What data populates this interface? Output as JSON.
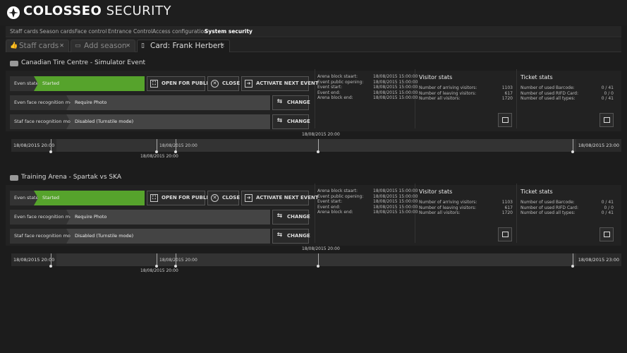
{
  "app": {
    "brand_bold": "COLOSSEO",
    "brand_rest": "SECURITY",
    "logo_icon": "colosseo-logo-icon"
  },
  "nav": {
    "items": [
      {
        "label": "Staff cards"
      },
      {
        "label": "Season cards"
      },
      {
        "label": "Face control"
      },
      {
        "label": "Entrance Control"
      },
      {
        "label": "Access configuration"
      },
      {
        "label": "System security"
      }
    ],
    "active": "System security"
  },
  "tabs": [
    {
      "label": "Staff cards",
      "icon": "thumbs-up-icon",
      "close": "✕",
      "active": false
    },
    {
      "label": "Add season",
      "icon": "card-icon",
      "close": "✕",
      "active": false
    },
    {
      "label": "Card: Frank Herbert",
      "icon": "document-icon",
      "close": "✕",
      "active": true
    }
  ],
  "events": [
    {
      "title": "Canadian Tire Centre - Simulator Event",
      "state_label": "Even state",
      "state_value": "Started",
      "state_color": "#56a32c",
      "buttons": {
        "open_public": "OPEN FOR PUBLIC",
        "close": "CLOSE",
        "activate_next": "ACTIVATE NEXT EVENT",
        "change": "CHANGE"
      },
      "face_mode_label": "Even face recognition mode",
      "face_mode_value": "Require Photo",
      "staff_mode_label": "Staf face recognition mode",
      "staff_mode_value": "Disabled (Turnstile mode)",
      "times": [
        {
          "label": "Arena block staart:",
          "value": "18/08/2015 15:00:00"
        },
        {
          "label": "Event public opening:",
          "value": "18/08/2015 15:00:00"
        },
        {
          "label": "Event start:",
          "value": "18/08/2015 15:00:00"
        },
        {
          "label": "Event end:",
          "value": "18/08/2015 15:00:00"
        },
        {
          "label": "Arena block end:",
          "value": "18/08/2015 15:00:00"
        }
      ],
      "visitor_title": "Visitor stats",
      "visitor_stats": [
        {
          "label": "Number of arriving visitors:",
          "value": "1103"
        },
        {
          "label": "Number of leaving visitors:",
          "value": "617"
        },
        {
          "label": "Number all visitors:",
          "value": "1720"
        }
      ],
      "ticket_title": "Ticket stats",
      "ticket_stats": [
        {
          "label": "Number of used Barcode:",
          "value": "0 / 41"
        },
        {
          "label": "Number of used RIFD Card:",
          "value": "0 / 0"
        },
        {
          "label": "Number of used all types:",
          "value": "0 / 41"
        }
      ],
      "timeline": {
        "start": "18/08/2015 20:00",
        "end": "18/08/2015 23:00",
        "mid_top": "18/08/2015 20:00",
        "mid_inline": "18/08/2015 20:00",
        "mid_bottom": "18/08/2015 20:00"
      }
    },
    {
      "title": "Training Arena - Spartak vs SKA",
      "state_label": "Even state",
      "state_value": "Started",
      "state_color": "#56a32c",
      "buttons": {
        "open_public": "OPEN FOR PUBLIC",
        "close": "CLOSE",
        "activate_next": "ACTIVATE NEXT EVENT",
        "change": "CHANGE"
      },
      "face_mode_label": "Even face recognition mode",
      "face_mode_value": "Require Photo",
      "staff_mode_label": "Staf face recognition mode",
      "staff_mode_value": "Disabled (Turnstile mode)",
      "times": [
        {
          "label": "Arena block staart:",
          "value": "18/08/2015 15:00:00"
        },
        {
          "label": "Event public opening:",
          "value": "18/08/2015 15:00:00"
        },
        {
          "label": "Event start:",
          "value": "18/08/2015 15:00:00"
        },
        {
          "label": "Event end:",
          "value": "18/08/2015 15:00:00"
        },
        {
          "label": "Arena block end:",
          "value": "18/08/2015 15:00:00"
        }
      ],
      "visitor_title": "Visitor stats",
      "visitor_stats": [
        {
          "label": "Number of arriving visitors:",
          "value": "1103"
        },
        {
          "label": "Number of leaving visitors:",
          "value": "617"
        },
        {
          "label": "Number all visitors:",
          "value": "1720"
        }
      ],
      "ticket_title": "Ticket stats",
      "ticket_stats": [
        {
          "label": "Number of used Barcode:",
          "value": "0 / 41"
        },
        {
          "label": "Number of used RIFD Card:",
          "value": "0 / 0"
        },
        {
          "label": "Number of used all types:",
          "value": "0 / 41"
        }
      ],
      "timeline": {
        "start": "18/08/2015 20:00",
        "end": "18/08/2015 23:00",
        "mid_top": "18/08/2015 20:00",
        "mid_inline": "18/08/2015 20:00",
        "mid_bottom": "18/08/2015 20:00"
      }
    }
  ]
}
